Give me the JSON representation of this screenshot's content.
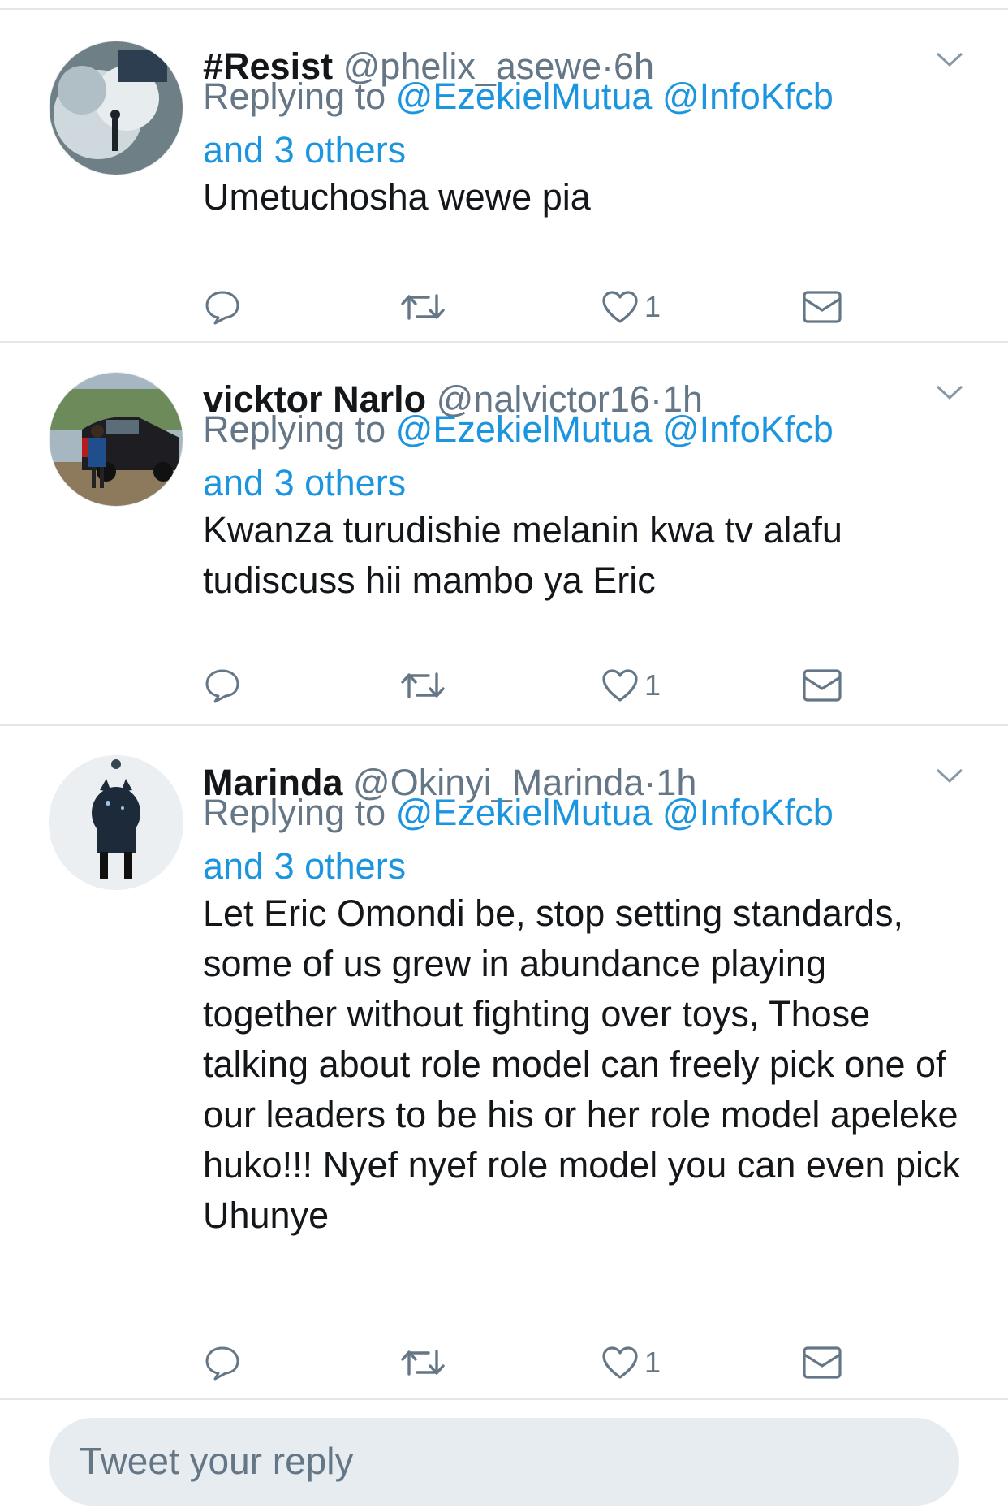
{
  "tweets": [
    {
      "display_name": "#Resist",
      "handle": "@phelix_asewe",
      "separator": "·",
      "age": "6h",
      "replying_prefix": "Replying to ",
      "mention_1": "@EzekielMutua",
      "mention_2": "@InfoKfcb",
      "others": "and 3 others",
      "text": "Umetuchosha wewe pia",
      "like_count": "1",
      "avatar_icon": "avatar-teargas-protest"
    },
    {
      "display_name": "vicktor Narlo",
      "handle": "@nalvictor16",
      "separator": "·",
      "age": "1h",
      "replying_prefix": "Replying to ",
      "mention_1": "@EzekielMutua",
      "mention_2": "@InfoKfcb",
      "others": "and 3 others",
      "text": "Kwanza turudishie melanin kwa tv alafu tudiscuss hii mambo ya Eric",
      "like_count": "1",
      "avatar_icon": "avatar-man-with-car"
    },
    {
      "display_name": "Marinda",
      "handle": "@Okinyi_Marinda",
      "separator": "·",
      "age": "1h",
      "replying_prefix": "Replying to ",
      "mention_1": "@EzekielMutua",
      "mention_2": "@InfoKfcb",
      "others": "and 3 others",
      "text": "Let Eric Omondi be, stop setting standards, some of us grew in abundance playing together without fighting over toys, Those talking about role model can freely pick one of our leaders to be his or her role model apeleke huko!!! Nyef nyef role model you can even pick Uhunye",
      "like_count": "1",
      "avatar_icon": "avatar-wolf-art"
    }
  ],
  "composer": {
    "placeholder": "Tweet your reply"
  },
  "colors": {
    "link": "#1b95e0",
    "secondary": "#657786",
    "divider": "#e1e8ed",
    "composer_bg": "#e6ecf0"
  }
}
